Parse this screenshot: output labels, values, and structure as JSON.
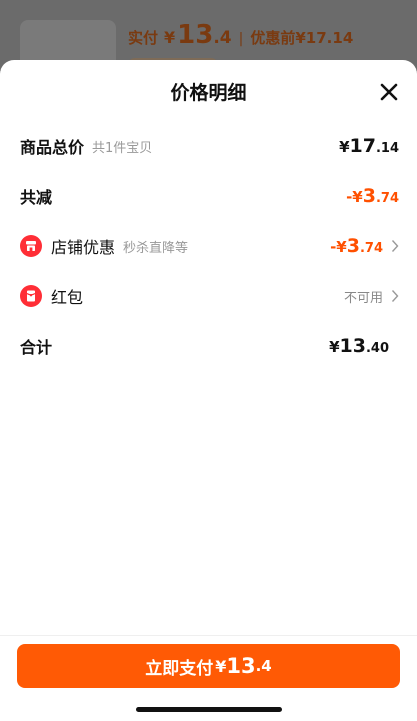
{
  "background": {
    "paid_label": "实付",
    "currency": "¥",
    "paid_int": "13",
    "paid_dec": ".4",
    "separator": "|",
    "original_label": "优惠前",
    "original_price": "¥17.14"
  },
  "sheet": {
    "title": "价格明细",
    "close_icon": "close-icon"
  },
  "rows": {
    "goods_total": {
      "label": "商品总价",
      "sub": "共1件宝贝",
      "currency": "¥",
      "int": "17",
      "dec": ".14"
    },
    "total_discount": {
      "label": "共减",
      "currency": "-¥",
      "int": "3",
      "dec": ".74"
    },
    "shop_discount": {
      "icon": "shop-icon",
      "label": "店铺优惠",
      "sub": "秒杀直降等",
      "currency": "-¥",
      "int": "3",
      "dec": ".74"
    },
    "red_packet": {
      "icon": "red-packet-icon",
      "label": "红包",
      "status": "不可用"
    },
    "sum": {
      "label": "合计",
      "currency": "¥",
      "int": "13",
      "dec": ".40"
    }
  },
  "footer": {
    "pay_label": "立即支付",
    "currency": "¥",
    "int": "13",
    "dec": ".4"
  },
  "colors": {
    "accent": "#ff5000",
    "button": "#ff5a05",
    "badge": "#ff2e36"
  }
}
